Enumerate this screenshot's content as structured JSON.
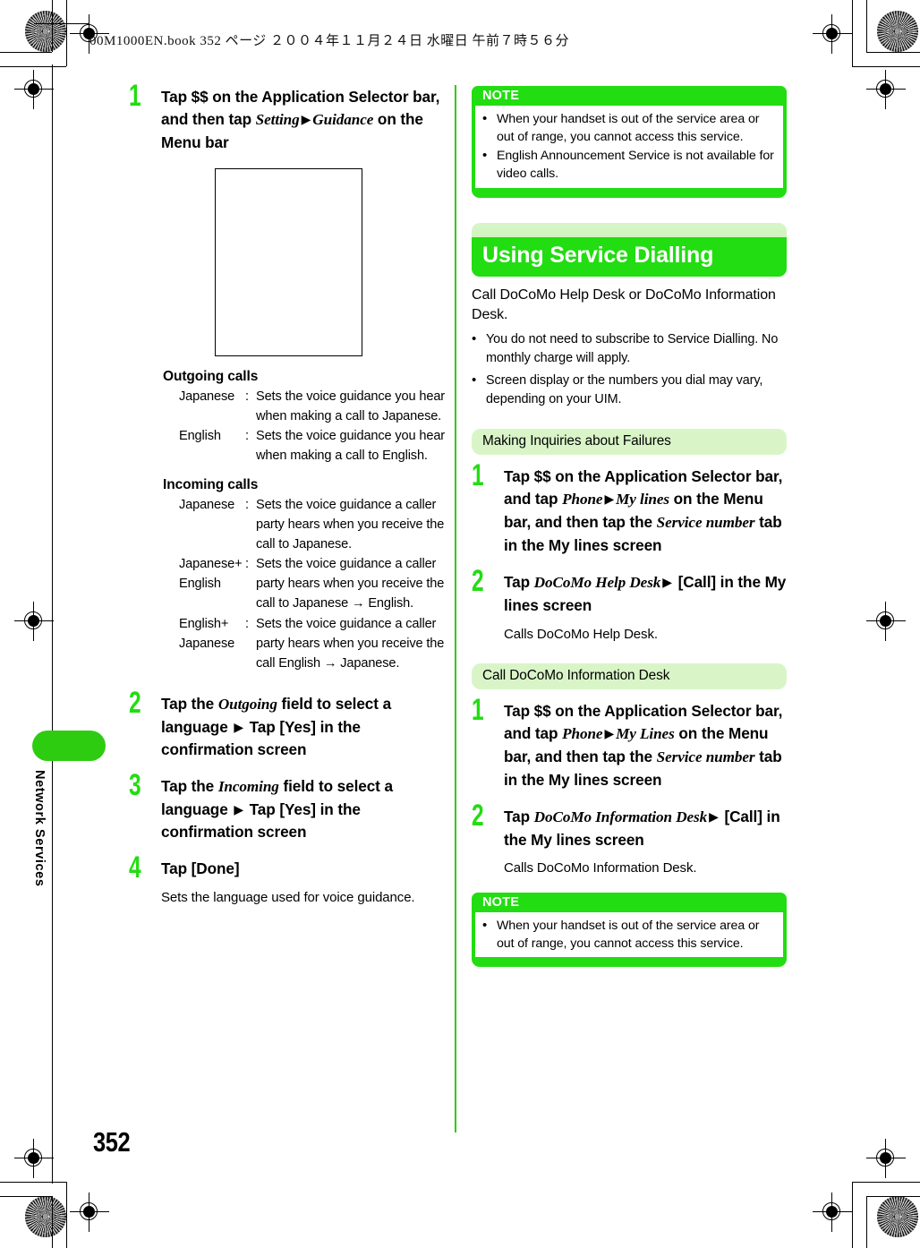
{
  "page": {
    "file_header": "00M1000EN.book   352 ページ   ２００４年１１月２４日   水曜日   午前７時５６分",
    "number": "352",
    "side_tab_label": "Network Services"
  },
  "colors": {
    "brand_green": "#22dd11",
    "light_green": "#d9f5c8",
    "divider_green": "#2ecc11",
    "note_white": "#ffffff"
  },
  "left_column": {
    "step1": {
      "num": "1",
      "t1": "Tap $$ on the Application Selector bar, and then tap ",
      "i1": "Setting",
      "arrow": "▶",
      "i2": "Guidance",
      "t2": " on the Menu bar"
    },
    "outgoing": {
      "title": "Outgoing calls",
      "rows": [
        {
          "term": "Japanese",
          "colon": ":",
          "desc": "Sets the voice guidance you hear when making a call to Japanese."
        },
        {
          "term": "English",
          "colon": ":",
          "desc": "Sets the voice guidance you hear when making a call to English."
        }
      ]
    },
    "incoming": {
      "title": "Incoming calls",
      "rows": [
        {
          "term": "Japanese",
          "colon": ":",
          "desc": "Sets the voice guidance a caller party hears when you receive the call to Japanese."
        },
        {
          "term": "Japanese+ English",
          "colon": ":",
          "desc": "Sets the voice guidance a caller party hears when you receive the call to Japanese → English."
        },
        {
          "term": "English+ Japanese",
          "colon": ":",
          "desc": "Sets the voice guidance a caller party hears when you receive the call English → Japanese."
        }
      ]
    },
    "step2": {
      "num": "2",
      "t1": "Tap the ",
      "i1": "Outgoing",
      "t2": " field to select a language ",
      "arrow": "▶",
      "t3": " Tap [Yes] in the confirmation screen"
    },
    "step3": {
      "num": "3",
      "t1": "Tap the ",
      "i1": "Incoming",
      "t2": " field to select a language ",
      "arrow": "▶",
      "t3": " Tap [Yes] in the confirmation screen"
    },
    "step4": {
      "num": "4",
      "t1": "Tap [Done]",
      "sub": "Sets the language used for voice guidance."
    }
  },
  "right_column": {
    "note_top": {
      "heading": "NOTE",
      "bullets": [
        "When your handset is out of the service area or out of range, you cannot access this service.",
        "English Announcement Service is not available for video calls."
      ]
    },
    "section": {
      "title": "Using Service Dialling",
      "lead": "Call DoCoMo Help Desk or DoCoMo Information Desk.",
      "bullets": [
        "You do not need to subscribe to Service Dialling. No monthly charge will apply.",
        "Screen display or the numbers you dial may vary, depending on your UIM."
      ]
    },
    "sub1": {
      "heading": "Making Inquiries about Failures",
      "step1": {
        "num": "1",
        "t1": "Tap $$ on the Application Selector bar, and tap ",
        "i1": "Phone",
        "arrow": "▶",
        "i2": "My lines",
        "t2": " on the Menu bar, and then tap the ",
        "i3": "Service number",
        "t3": " tab in the My lines screen"
      },
      "step2": {
        "num": "2",
        "t1": "Tap ",
        "i1": "DoCoMo Help Desk",
        "arrow": "▶",
        "t2": " [Call] in the My lines screen",
        "sub": "Calls DoCoMo Help Desk."
      }
    },
    "sub2": {
      "heading": "Call DoCoMo Information Desk",
      "step1": {
        "num": "1",
        "t1": "Tap $$ on the Application Selector bar, and tap ",
        "i1": "Phone",
        "arrow": "▶",
        "i2": "My Lines",
        "t2": " on the Menu bar, and then tap the ",
        "i3": "Service number",
        "t3": " tab in the My lines screen"
      },
      "step2": {
        "num": "2",
        "t1": "Tap ",
        "i1": "DoCoMo Information Desk",
        "arrow": "▶",
        "t2": " [Call] in the My lines screen",
        "sub": "Calls DoCoMo Information Desk."
      }
    },
    "note_bottom": {
      "heading": "NOTE",
      "bullets": [
        "When your handset is out of the service area or out of range, you cannot access this service."
      ]
    }
  },
  "bullet_char": "•"
}
